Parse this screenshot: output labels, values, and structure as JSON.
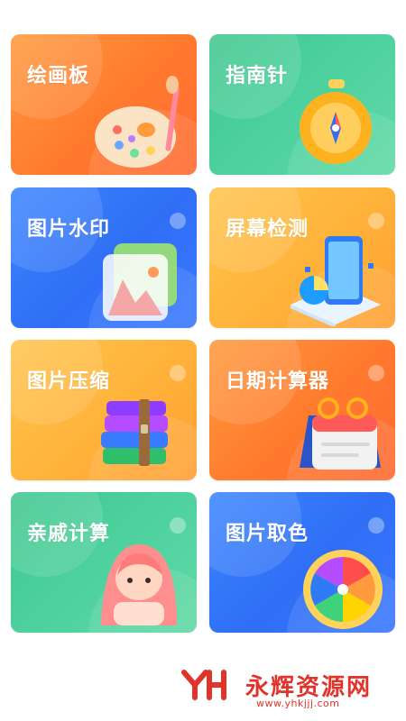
{
  "tools": [
    {
      "title": "绘画板",
      "icon": "palette-icon",
      "theme": "orange",
      "accent": "#ff7a2e"
    },
    {
      "title": "指南针",
      "icon": "compass-icon",
      "theme": "green",
      "accent": "#45c894"
    },
    {
      "title": "图片水印",
      "icon": "image-watermark-icon",
      "theme": "blue",
      "accent": "#3b82f6"
    },
    {
      "title": "屏幕检测",
      "icon": "screen-test-icon",
      "theme": "yellow",
      "accent": "#ffb23a"
    },
    {
      "title": "图片压缩",
      "icon": "archive-books-icon",
      "theme": "yellow",
      "accent": "#ffb23a"
    },
    {
      "title": "日期计算器",
      "icon": "calendar-icon",
      "theme": "orange",
      "accent": "#ff7a2e"
    },
    {
      "title": "亲戚计算",
      "icon": "girl-character-icon",
      "theme": "green",
      "accent": "#45c894"
    },
    {
      "title": "图片取色",
      "icon": "color-wheel-icon",
      "theme": "blue",
      "accent": "#3b82f6"
    }
  ],
  "watermark": {
    "logo_icon": "yh-logo-icon",
    "brand": "永辉资源网",
    "url": "www.yhkjjj.com",
    "color": "#e0342b"
  }
}
